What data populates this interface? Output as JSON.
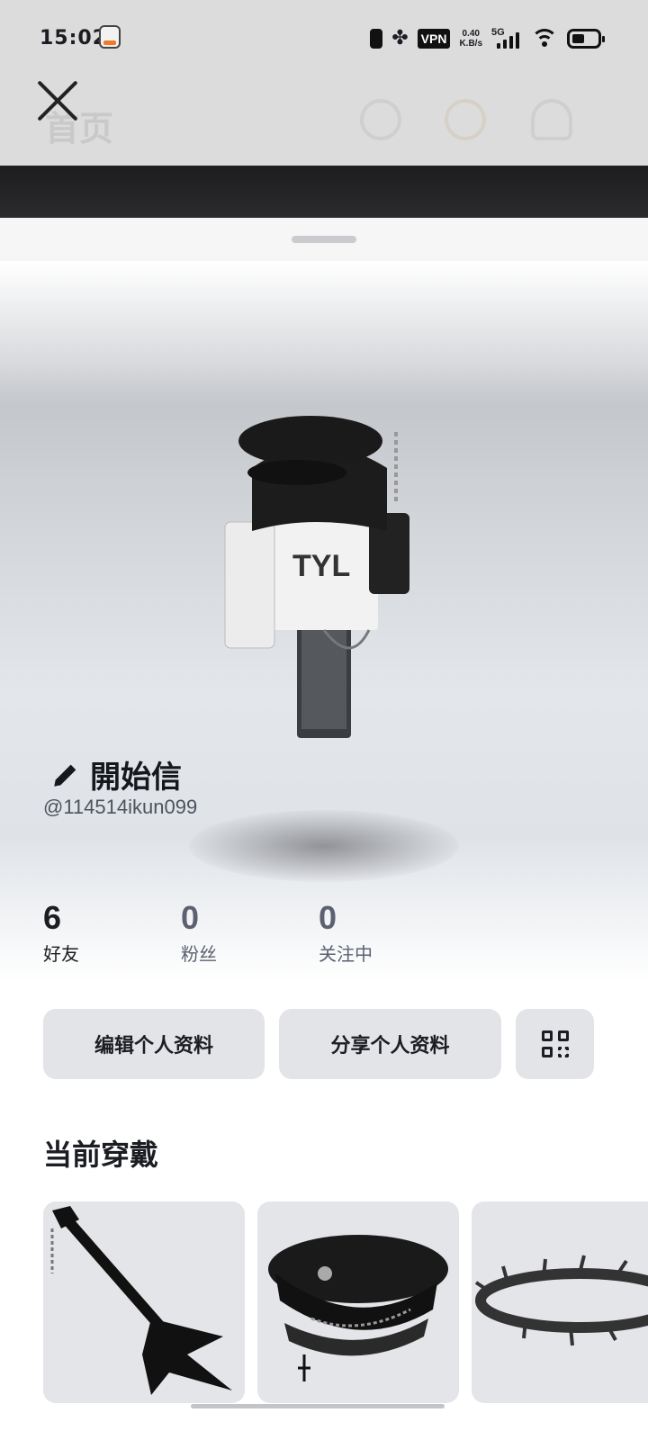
{
  "status_bar": {
    "time": "15:02",
    "vpn": "VPN",
    "speed_value": "0.40",
    "speed_unit": "K.B/s",
    "network": "5G"
  },
  "header": {
    "title": "首页"
  },
  "profile": {
    "display_name": "開始信",
    "username": "@114514ikun099",
    "stats": [
      {
        "value": "6",
        "label": "好友"
      },
      {
        "value": "0",
        "label": "粉丝"
      },
      {
        "value": "0",
        "label": "关注中"
      }
    ]
  },
  "actions": {
    "edit_label": "编辑个人资料",
    "share_label": "分享个人资料",
    "qr_icon": "qr-code-icon"
  },
  "wearing": {
    "title": "当前穿戴",
    "items": [
      "guitar",
      "military-cap",
      "thorn-crown"
    ]
  },
  "colors": {
    "status_bg": "#dcdcdc",
    "button_bg": "#e3e4e8",
    "card_bg": "#e4e5e9",
    "text": "#1b1d22",
    "muted": "#5c6172"
  }
}
